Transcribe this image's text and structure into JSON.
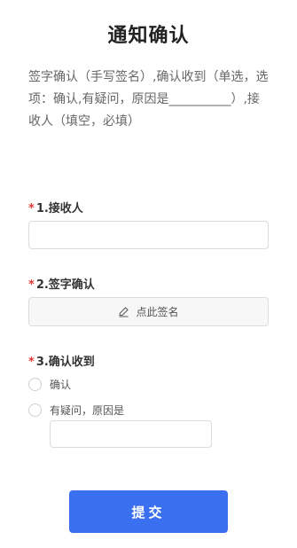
{
  "form": {
    "title": "通知确认",
    "description": "签字确认（手写签名）,确认收到（单选，选项：确认,有疑问，原因是__________）,接收人（填空，必填）"
  },
  "questions": [
    {
      "number": "1.",
      "label": "接收人",
      "required_mark": "*",
      "type": "text",
      "value": ""
    },
    {
      "number": "2.",
      "label": "签字确认",
      "required_mark": "*",
      "type": "signature",
      "button_label": "点此签名",
      "icon": "pen-icon"
    },
    {
      "number": "3.",
      "label": "确认收到",
      "required_mark": "*",
      "type": "radio",
      "options": [
        {
          "label": "确认",
          "selected": false
        },
        {
          "label": "有疑问，原因是",
          "selected": false,
          "has_input": true,
          "input_value": ""
        }
      ]
    }
  ],
  "submit": {
    "label": "提交"
  },
  "colors": {
    "accent": "#3a6ff0",
    "required": "#e53935"
  }
}
